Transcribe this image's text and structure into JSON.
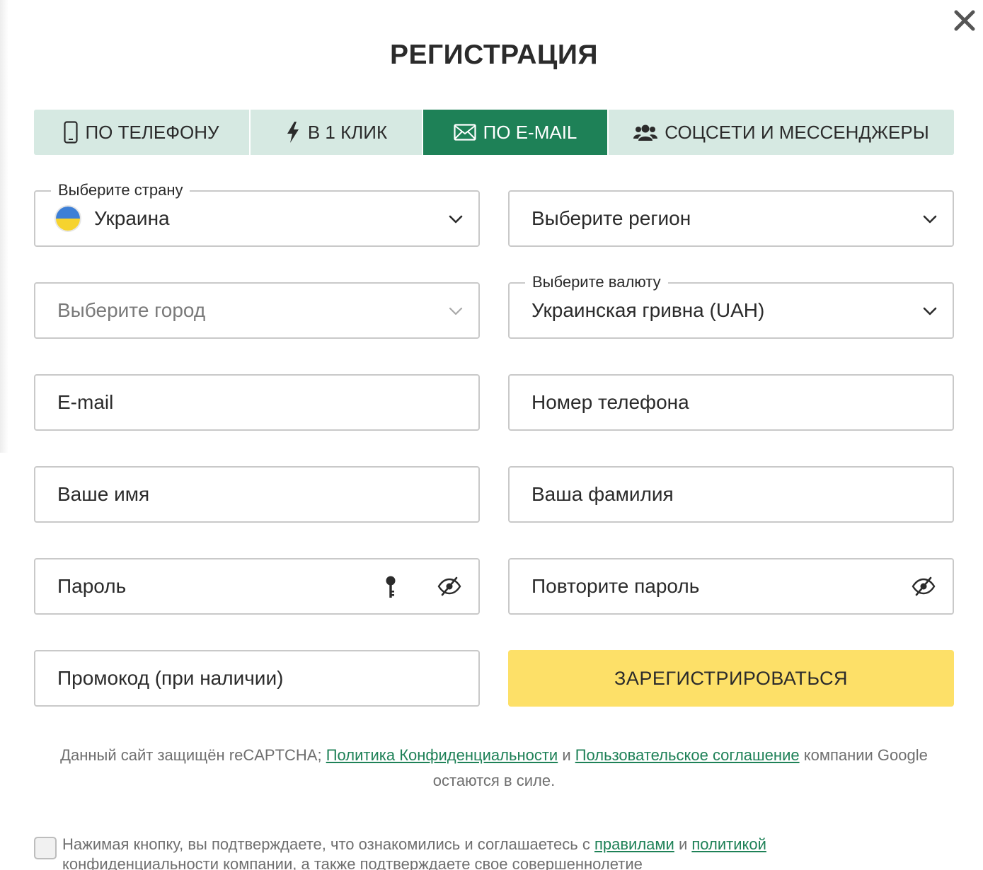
{
  "dialog": {
    "title": "РЕГИСТРАЦИЯ",
    "close_icon": "close-icon"
  },
  "tabs": [
    {
      "label": "ПО ТЕЛЕФОНУ",
      "icon": "phone-icon",
      "active": false
    },
    {
      "label": "В 1 КЛИК",
      "icon": "lightning-icon",
      "active": false
    },
    {
      "label": "ПО E-MAIL",
      "icon": "envelope-icon",
      "active": true
    },
    {
      "label": "СОЦСЕТИ И МЕССЕНДЖЕРЫ",
      "icon": "users-icon",
      "active": false
    }
  ],
  "form": {
    "country": {
      "legend": "Выберите страну",
      "value": "Украина"
    },
    "region": {
      "placeholder": "Выберите регион"
    },
    "city": {
      "placeholder": "Выберите город"
    },
    "currency": {
      "legend": "Выберите валюту",
      "value": "Украинская гривна (UAH)"
    },
    "email": {
      "placeholder": "E-mail"
    },
    "phone": {
      "placeholder": "Номер телефона"
    },
    "first_name": {
      "placeholder": "Ваше имя"
    },
    "last_name": {
      "placeholder": "Ваша фамилия"
    },
    "password": {
      "placeholder": "Пароль"
    },
    "password_repeat": {
      "placeholder": "Повторите пароль"
    },
    "promo": {
      "placeholder": "Промокод (при наличии)"
    },
    "submit_label": "ЗАРЕГИСТРИРОВАТЬСЯ"
  },
  "recaptcha": {
    "text_before": "Данный сайт защищён reCAPTCHA; ",
    "privacy_link": "Политика Конфиденциальности",
    "and": " и ",
    "terms_link": "Пользовательское соглашение",
    "text_after": " компании Google остаются в силе."
  },
  "consent": {
    "text_before": "Нажимая кнопку, вы подтверждаете, что ознакомились и соглашаетесь с ",
    "rules_link": "правилами",
    "and": " и ",
    "policy_link": "политикой",
    "text_after": " конфиденциальности компании, а также подтверждаете свое совершеннолетие"
  },
  "colors": {
    "accent_green": "#1e8157",
    "tab_bg": "#d6e9e2",
    "button_yellow": "#fde068"
  }
}
